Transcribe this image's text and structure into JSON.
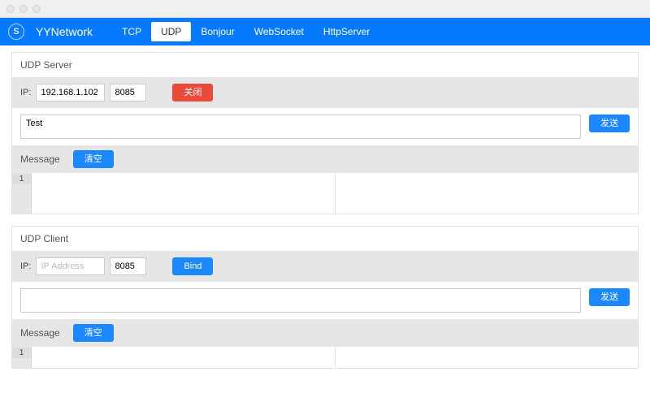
{
  "app": {
    "title": "YYNetwork",
    "logo_letter": "S"
  },
  "nav": {
    "tabs": [
      {
        "label": "TCP",
        "active": false
      },
      {
        "label": "UDP",
        "active": true
      },
      {
        "label": "Bonjour",
        "active": false
      },
      {
        "label": "WebSocket",
        "active": false
      },
      {
        "label": "HttpServer",
        "active": false
      }
    ]
  },
  "server": {
    "title": "UDP Server",
    "ip_label": "IP:",
    "ip_value": "192.168.1.102",
    "port_value": "8085",
    "action_label": "关闭",
    "send_value": "Test",
    "send_btn": "发送",
    "message_label": "Message",
    "clear_btn": "清空",
    "row_num": "1"
  },
  "client": {
    "title": "UDP Client",
    "ip_label": "IP:",
    "ip_placeholder": "IP Address",
    "ip_value": "",
    "port_value": "8085",
    "action_label": "Bind",
    "send_value": "",
    "send_btn": "发送",
    "message_label": "Message",
    "clear_btn": "清空",
    "row_num": "1"
  }
}
